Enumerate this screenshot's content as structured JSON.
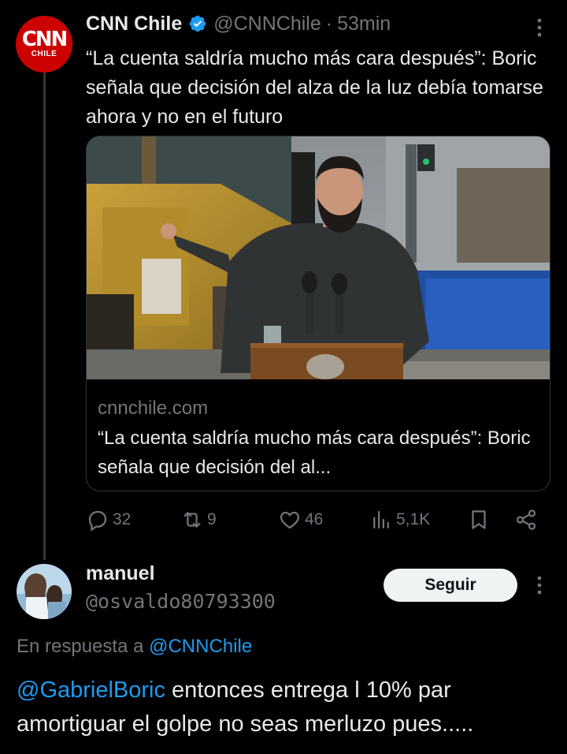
{
  "tweet": {
    "account_logo": "CNN",
    "account_logo_sub": "CHILE",
    "display_name": "CNN Chile",
    "handle": "@CNNChile",
    "separator": "·",
    "time": "53min",
    "text": "“La cuenta saldría mucho más cara después”: Boric señala que decisión del alza de la luz debía tomarse ahora y no en el futuro",
    "card": {
      "image_description": "press-photo-speaker-at-podium",
      "domain": "cnnchile.com",
      "title": "“La cuenta saldría mucho más cara después”: Boric señala que decisión del al..."
    },
    "actions": {
      "replies": "32",
      "retweets": "9",
      "likes": "46",
      "views": "5,1K"
    }
  },
  "reply": {
    "display_name": "manuel",
    "handle": "@osvaldo80793300",
    "follow_label": "Seguir",
    "in_reply_prefix": "En respuesta a",
    "in_reply_mention": "@CNNChile",
    "mention": "@GabrielBoric",
    "text": " entonces entrega l 10% par amortiguar el golpe no seas merluzo pues....."
  },
  "colors": {
    "background": "#000000",
    "text": "#e7e9ea",
    "muted": "#71767b",
    "link": "#1d9bf0",
    "verified": "#1d9bf0",
    "cnn_red": "#cc0000",
    "follow_button": "#eff3f4"
  }
}
